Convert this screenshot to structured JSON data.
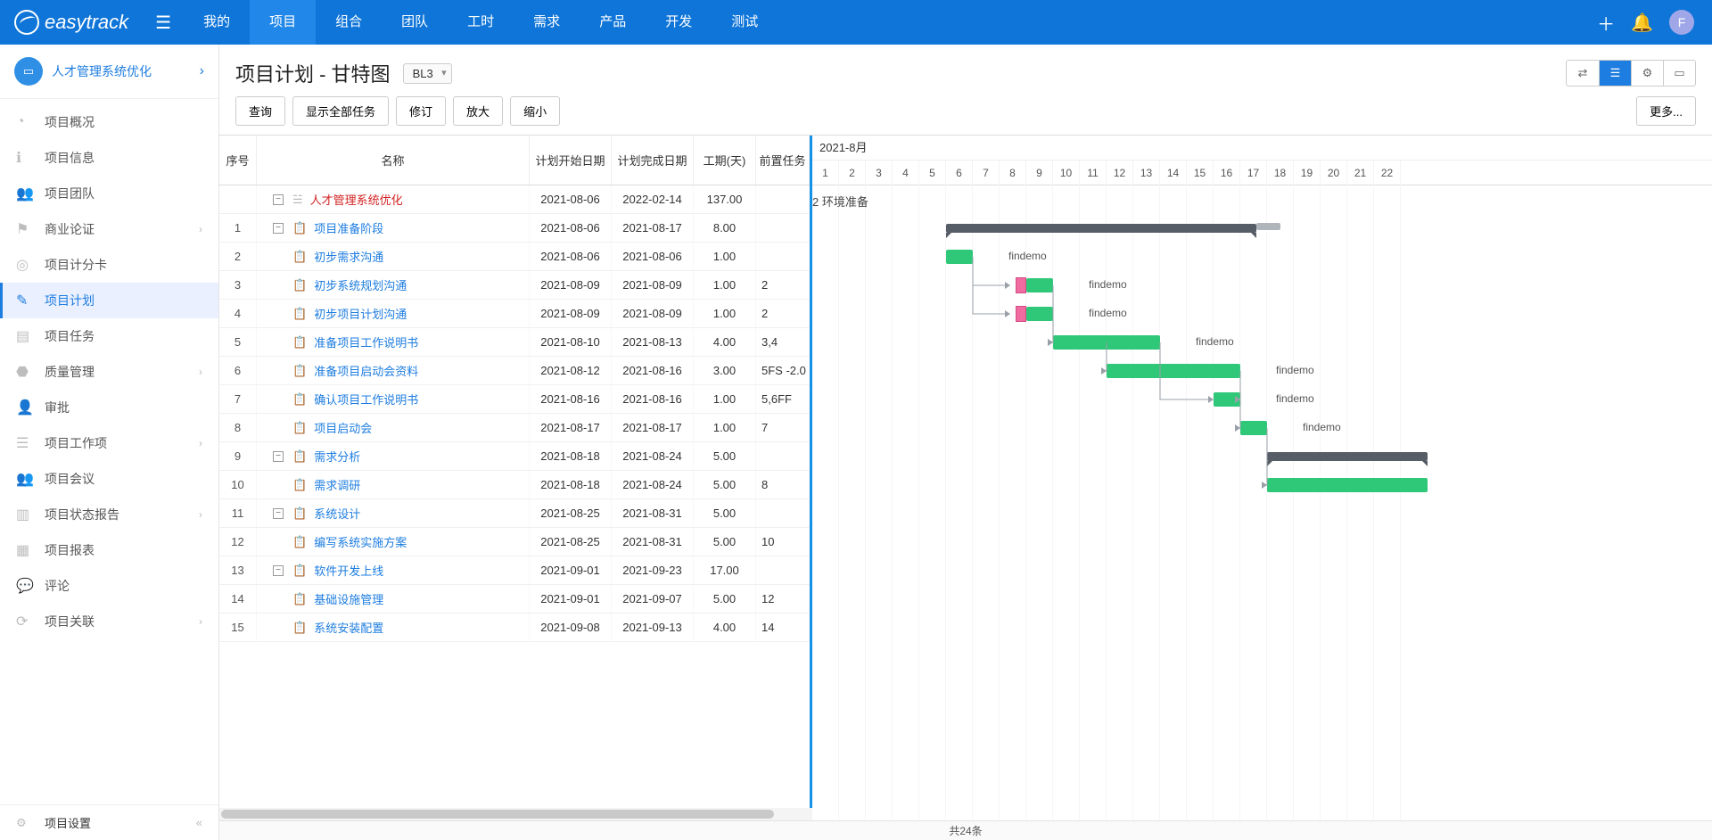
{
  "brand": "easytrack",
  "topnav": {
    "items": [
      {
        "label": "我的"
      },
      {
        "label": "项目",
        "active": true
      },
      {
        "label": "组合"
      },
      {
        "label": "团队"
      },
      {
        "label": "工时"
      },
      {
        "label": "需求"
      },
      {
        "label": "产品"
      },
      {
        "label": "开发"
      },
      {
        "label": "测试"
      }
    ],
    "avatar": "F"
  },
  "sidebar": {
    "project_name": "人才管理系统优化",
    "items": [
      {
        "icon": "◔",
        "label": "项目概况"
      },
      {
        "icon": "ℹ",
        "label": "项目信息"
      },
      {
        "icon": "👥",
        "label": "项目团队"
      },
      {
        "icon": "⚑",
        "label": "商业论证",
        "expandable": true
      },
      {
        "icon": "◎",
        "label": "项目计分卡"
      },
      {
        "icon": "✎",
        "label": "项目计划",
        "active": true
      },
      {
        "icon": "▤",
        "label": "项目任务"
      },
      {
        "icon": "⬣",
        "label": "质量管理",
        "expandable": true
      },
      {
        "icon": "👤",
        "label": "审批"
      },
      {
        "icon": "☰",
        "label": "项目工作项",
        "expandable": true
      },
      {
        "icon": "👥",
        "label": "项目会议"
      },
      {
        "icon": "▥",
        "label": "项目状态报告",
        "expandable": true
      },
      {
        "icon": "▦",
        "label": "项目报表"
      },
      {
        "icon": "💬",
        "label": "评论"
      },
      {
        "icon": "⟳",
        "label": "项目关联",
        "expandable": true
      }
    ],
    "footer": {
      "icon": "⚙",
      "label": "项目设置"
    }
  },
  "page": {
    "title": "项目计划 - 甘特图",
    "baseline": "BL3"
  },
  "toolbar": {
    "query": "查询",
    "show_all": "显示全部任务",
    "revision": "修订",
    "zoom_in": "放大",
    "zoom_out": "缩小",
    "more": "更多..."
  },
  "grid": {
    "headers": {
      "idx": "序号",
      "name": "名称",
      "start": "计划开始日期",
      "end": "计划完成日期",
      "dur": "工期(天)",
      "pred": "前置任务"
    },
    "rows": [
      {
        "idx": "",
        "level": 0,
        "root": true,
        "name": "人才管理系统优化",
        "start": "2021-08-06",
        "end": "2022-02-14",
        "dur": "137.00",
        "pred": ""
      },
      {
        "idx": "1",
        "level": 0,
        "summary": true,
        "name": "项目准备阶段",
        "start": "2021-08-06",
        "end": "2021-08-17",
        "dur": "8.00",
        "pred": ""
      },
      {
        "idx": "2",
        "level": 1,
        "name": "初步需求沟通",
        "start": "2021-08-06",
        "end": "2021-08-06",
        "dur": "1.00",
        "pred": ""
      },
      {
        "idx": "3",
        "level": 1,
        "name": "初步系统规划沟通",
        "start": "2021-08-09",
        "end": "2021-08-09",
        "dur": "1.00",
        "pred": "2"
      },
      {
        "idx": "4",
        "level": 1,
        "name": "初步项目计划沟通",
        "start": "2021-08-09",
        "end": "2021-08-09",
        "dur": "1.00",
        "pred": "2"
      },
      {
        "idx": "5",
        "level": 1,
        "name": "准备项目工作说明书",
        "start": "2021-08-10",
        "end": "2021-08-13",
        "dur": "4.00",
        "pred": "3,4"
      },
      {
        "idx": "6",
        "level": 1,
        "name": "准备项目启动会资料",
        "start": "2021-08-12",
        "end": "2021-08-16",
        "dur": "3.00",
        "pred": "5FS -2.0"
      },
      {
        "idx": "7",
        "level": 1,
        "name": "确认项目工作说明书",
        "start": "2021-08-16",
        "end": "2021-08-16",
        "dur": "1.00",
        "pred": "5,6FF"
      },
      {
        "idx": "8",
        "level": 1,
        "name": "项目启动会",
        "start": "2021-08-17",
        "end": "2021-08-17",
        "dur": "1.00",
        "pred": "7"
      },
      {
        "idx": "9",
        "level": 0,
        "summary": true,
        "name": "需求分析",
        "start": "2021-08-18",
        "end": "2021-08-24",
        "dur": "5.00",
        "pred": ""
      },
      {
        "idx": "10",
        "level": 1,
        "name": "需求调研",
        "start": "2021-08-18",
        "end": "2021-08-24",
        "dur": "5.00",
        "pred": "8"
      },
      {
        "idx": "11",
        "level": 0,
        "summary": true,
        "name": "系统设计",
        "start": "2021-08-25",
        "end": "2021-08-31",
        "dur": "5.00",
        "pred": ""
      },
      {
        "idx": "12",
        "level": 1,
        "name": "编写系统实施方案",
        "start": "2021-08-25",
        "end": "2021-08-31",
        "dur": "5.00",
        "pred": "10"
      },
      {
        "idx": "13",
        "level": 0,
        "summary": true,
        "name": "软件开发上线",
        "start": "2021-09-01",
        "end": "2021-09-23",
        "dur": "17.00",
        "pred": ""
      },
      {
        "idx": "14",
        "level": 1,
        "name": "基础设施管理",
        "start": "2021-09-01",
        "end": "2021-09-07",
        "dur": "5.00",
        "pred": "12"
      },
      {
        "idx": "15",
        "level": 1,
        "name": "系统安装配置",
        "start": "2021-09-08",
        "end": "2021-09-13",
        "dur": "4.00",
        "pred": "14"
      }
    ]
  },
  "chart": {
    "month": "2021-8月",
    "milestone_row0": "2 环境准备",
    "day_width": 30,
    "first_day": 1,
    "days": [
      1,
      2,
      3,
      4,
      5,
      6,
      7,
      8,
      9,
      10,
      11,
      12,
      13,
      14,
      15,
      16,
      17,
      18,
      19,
      20,
      21,
      22
    ],
    "bars": [
      {
        "row": 1,
        "type": "summary",
        "startDay": 6,
        "endDay": 17.6,
        "baselineEnd": 18.5
      },
      {
        "row": 2,
        "type": "task",
        "startDay": 6,
        "endDay": 7,
        "label": "findemo"
      },
      {
        "row": 3,
        "type": "task",
        "startDay": 9,
        "endDay": 10,
        "label": "findemo",
        "baselineAt": 8.6
      },
      {
        "row": 4,
        "type": "task",
        "startDay": 9,
        "endDay": 10,
        "label": "findemo",
        "baselineAt": 8.6
      },
      {
        "row": 5,
        "type": "task",
        "startDay": 10,
        "endDay": 14,
        "label": "findemo"
      },
      {
        "row": 6,
        "type": "task",
        "startDay": 12,
        "endDay": 17,
        "label": "findemo"
      },
      {
        "row": 7,
        "type": "task",
        "startDay": 16,
        "endDay": 17,
        "label": "findemo"
      },
      {
        "row": 8,
        "type": "task",
        "startDay": 17,
        "endDay": 18,
        "label": "findemo"
      },
      {
        "row": 9,
        "type": "summary",
        "startDay": 18,
        "endDay": 24
      },
      {
        "row": 10,
        "type": "task",
        "startDay": 18,
        "endDay": 24
      }
    ],
    "deps": [
      {
        "from": {
          "row": 2,
          "day": 7
        },
        "to": {
          "row": 3,
          "day": 8.4
        }
      },
      {
        "from": {
          "row": 2,
          "day": 7
        },
        "to": {
          "row": 4,
          "day": 8.4
        }
      },
      {
        "from": {
          "row": 3,
          "day": 10
        },
        "to": {
          "row": 5,
          "day": 10
        }
      },
      {
        "from": {
          "row": 4,
          "day": 10
        },
        "to": {
          "row": 5,
          "day": 10
        }
      },
      {
        "from": {
          "row": 5,
          "day": 12
        },
        "to": {
          "row": 6,
          "day": 12
        }
      },
      {
        "from": {
          "row": 5,
          "day": 14
        },
        "to": {
          "row": 7,
          "day": 16
        }
      },
      {
        "from": {
          "row": 6,
          "day": 17
        },
        "to": {
          "row": 7,
          "day": 17
        }
      },
      {
        "from": {
          "row": 7,
          "day": 17
        },
        "to": {
          "row": 8,
          "day": 17
        }
      },
      {
        "from": {
          "row": 8,
          "day": 18
        },
        "to": {
          "row": 10,
          "day": 18
        }
      }
    ]
  },
  "footer": {
    "count": "共24条"
  }
}
